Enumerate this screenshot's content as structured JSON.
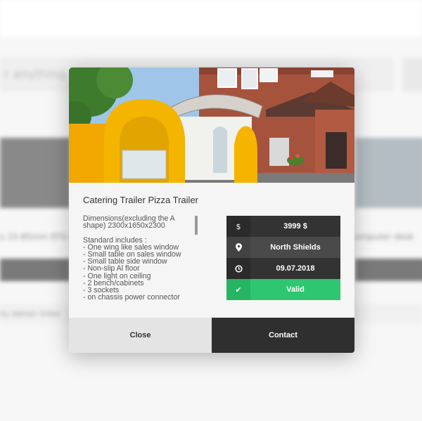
{
  "background": {
    "search_placeholder": "r anything",
    "left_item_title": "s 15-85mm EFS I",
    "right_item_title": "omputer desk",
    "author": "by Adrian Grbie"
  },
  "modal": {
    "title": "Catering Trailer Pizza Trailer",
    "description": "Dimensions(excluding the A shape) 2300x1650x2300\n\nStandard includes :\n- One wing like sales window\n- Small table on sales window\n- Small table side window\n- Non-slip Al floor\n- One light on ceiling\n- 2 bench/cabinets\n- 3 sockets\n- on chassis power connector",
    "info": [
      {
        "icon": "dollar-icon",
        "glyph": "$",
        "value": "3999 $"
      },
      {
        "icon": "location-pin-icon",
        "glyph": "📍",
        "value": "North Shields"
      },
      {
        "icon": "clock-icon",
        "glyph": "◷",
        "value": "09.07.2018"
      },
      {
        "icon": "check-icon",
        "glyph": "✔",
        "value": "Valid"
      }
    ],
    "close_label": "Close",
    "contact_label": "Contact"
  },
  "colors": {
    "valid_green": "#2ec770",
    "dark": "#333333",
    "trailer_yellow": "#f5b400"
  }
}
